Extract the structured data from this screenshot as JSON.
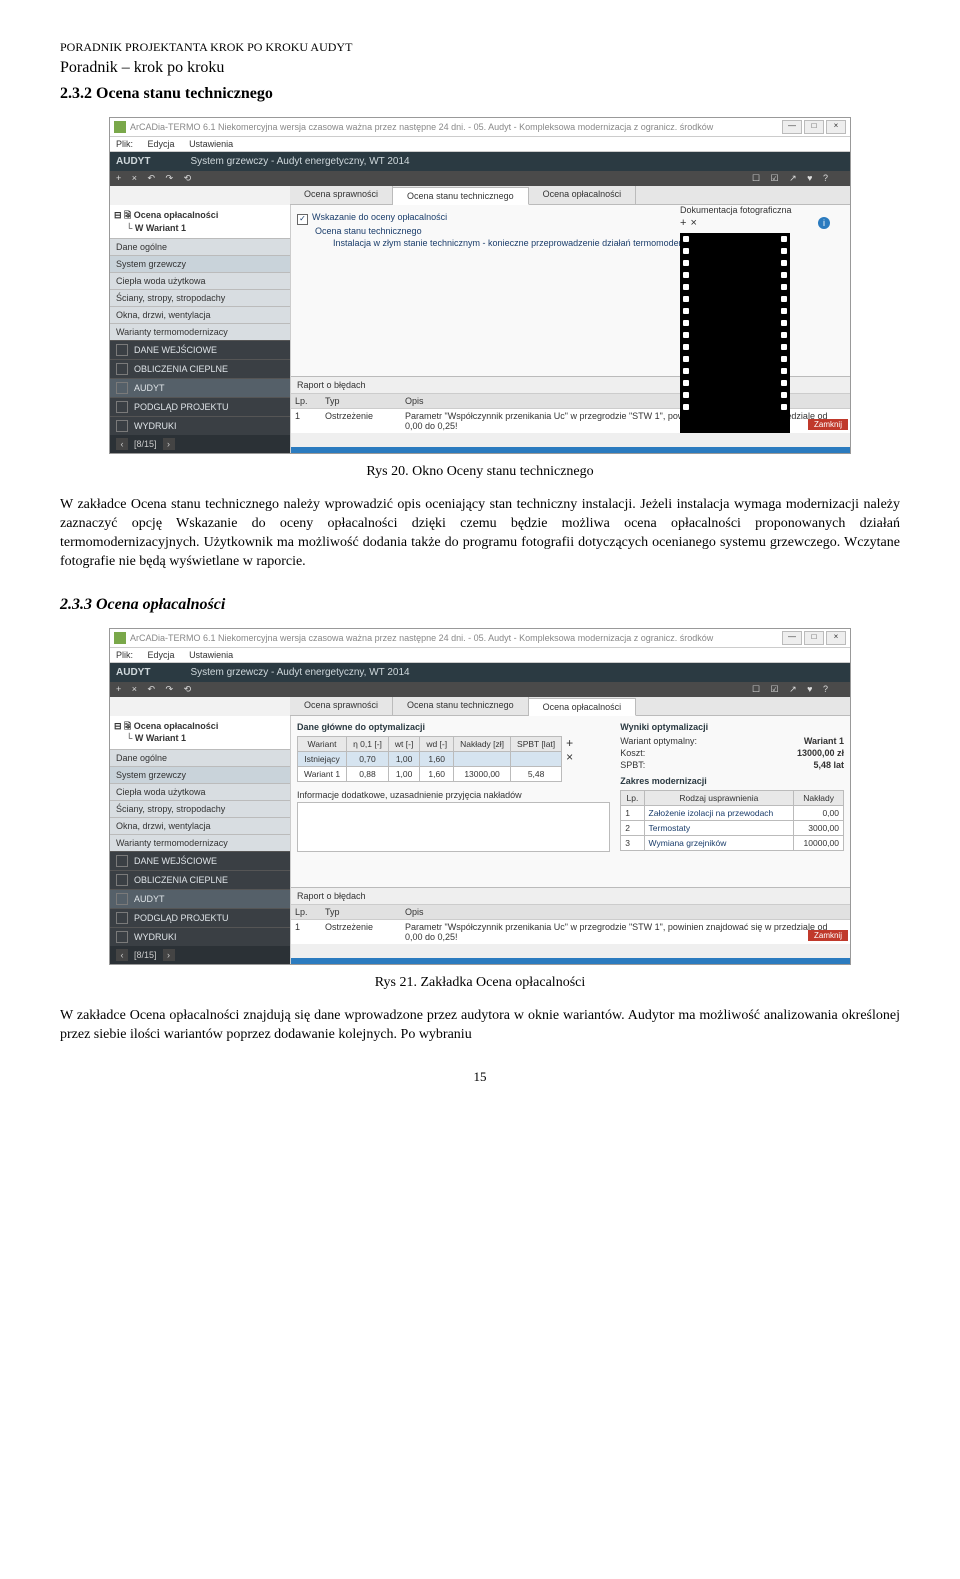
{
  "doc": {
    "header": "PORADNIK PROJEKTANTA KROK PO KROKU AUDYT",
    "subtitle": "Poradnik – krok  po kroku",
    "heading1": "2.3.2  Ocena stanu technicznego",
    "caption1": "Rys 20. Okno Oceny stanu technicznego",
    "para1": "W zakładce Ocena stanu technicznego należy wprowadzić opis oceniający stan techniczny instalacji. Jeżeli instalacja wymaga modernizacji należy zaznaczyć opcję Wskazanie do oceny opłacalności dzięki czemu będzie możliwa ocena opłacalności proponowanych działań termomodernizacyjnych. Użytkownik ma możliwość dodania także do programu fotografii dotyczących ocenianego systemu grzewczego. Wczytane fotografie nie będą wyświetlane w raporcie.",
    "heading2": "2.3.3  Ocena opłacalności",
    "caption2": "Rys 21. Zakładka Ocena opłacalności",
    "para2": "W zakładce Ocena opłacalności znajdują się dane wprowadzone przez audytora w oknie wariantów. Audytor ma możliwość analizowania określonej przez siebie ilości wariantów poprzez dodawanie kolejnych. Po wybraniu",
    "page_num": "15"
  },
  "app": {
    "title": "ArCADia-TERMO 6.1 Niekomercyjna wersja czasowa ważna przez następne 24 dni. - 05. Audyt - Kompleksowa modernizacja z ogranicz. środków",
    "menu": {
      "plik": "Plik:",
      "edycja": "Edycja",
      "ustawienia": "Ustawienia"
    },
    "ribbon": {
      "label": "AUDYT",
      "title": "System grzewczy - Audyt energetyczny, WT 2014"
    },
    "tool_icons_left": "+ × ↶ ↷ ⟲",
    "tool_icons_right": "☐ ☑ ↗ ♥ ?",
    "tabs": {
      "t1": "Ocena sprawności",
      "t2": "Ocena stanu technicznego",
      "t3": "Ocena opłacalności"
    },
    "tree": {
      "root": "Ocena opłacalności",
      "child": "W  Wariant 1"
    },
    "side_groups": {
      "g1": "Dane ogólne",
      "g2": "System grzewczy",
      "g3": "Ciepła woda użytkowa",
      "g4": "Ściany, stropy, stropodachy",
      "g5": "Okna, drzwi, wentylacja",
      "g6": "Warianty termomodernizacy"
    },
    "side_nav": {
      "n1": "DANE WEJŚCIOWE",
      "n2": "OBLICZENIA CIEPLNE",
      "n3": "AUDYT",
      "n4": "PODGLĄD PROJEKTU",
      "n5": "WYDRUKI"
    },
    "paging": "[8/15]",
    "err": {
      "title": "Raport o błędach",
      "h1": "Lp.",
      "h2": "Typ",
      "h3": "Opis",
      "r1": "1",
      "r2": "Ostrzeżenie",
      "r3": "Parametr \"Współczynnik przenikania Uc\" w przegrodzie \"STW 1\", powinien znajdować się w przedziale od 0,00 do 0,25!"
    },
    "close": "Zamknij"
  },
  "shot1": {
    "chk1": "Wskazanie do oceny opłacalności",
    "lab1": "Ocena stanu technicznego",
    "desc": "Instalacja w złym stanie technicznym - konieczne przeprowadzenie działań termomodernizacyjnych",
    "foto_head": "Dokumentacja fotograficzna",
    "foto_tools": "+ ×"
  },
  "shot2": {
    "left_head": "Dane główne do optymalizacji",
    "right_head": "Wyniki optymalizacji",
    "th": {
      "wariant": "Wariant",
      "n": "η 0,1 [-]",
      "wt": "wt [-]",
      "wd": "wd [-]",
      "nak": "Nakłady [zł]",
      "spbt": "SPBT [lat]"
    },
    "rows": [
      {
        "w": "Istniejący",
        "n": "0,70",
        "wt": "1,00",
        "wd": "1,60",
        "nak": "",
        "spbt": ""
      },
      {
        "w": "Wariant 1",
        "n": "0,88",
        "wt": "1,00",
        "wd": "1,60",
        "nak": "13000,00",
        "spbt": "5,48"
      }
    ],
    "plus": "+",
    "x": "×",
    "kv1": {
      "k": "Wariant optymalny:",
      "v": "Wariant 1"
    },
    "kv2": {
      "k": "Koszt:",
      "v": "13000,00 zł"
    },
    "kv3": {
      "k": "SPBT:",
      "v": "5,48 lat"
    },
    "zakres": "Zakres modernizacji",
    "mth": {
      "lp": "Lp.",
      "r": "Rodzaj usprawnienia",
      "n": "Nakłady"
    },
    "mrows": [
      {
        "lp": "1",
        "r": "Założenie izolacji na przewodach",
        "n": "0,00"
      },
      {
        "lp": "2",
        "r": "Termostaty",
        "n": "3000,00"
      },
      {
        "lp": "3",
        "r": "Wymiana grzejników",
        "n": "10000,00"
      }
    ],
    "info_label": "Informacje dodatkowe, uzasadnienie przyjęcia nakładów"
  }
}
